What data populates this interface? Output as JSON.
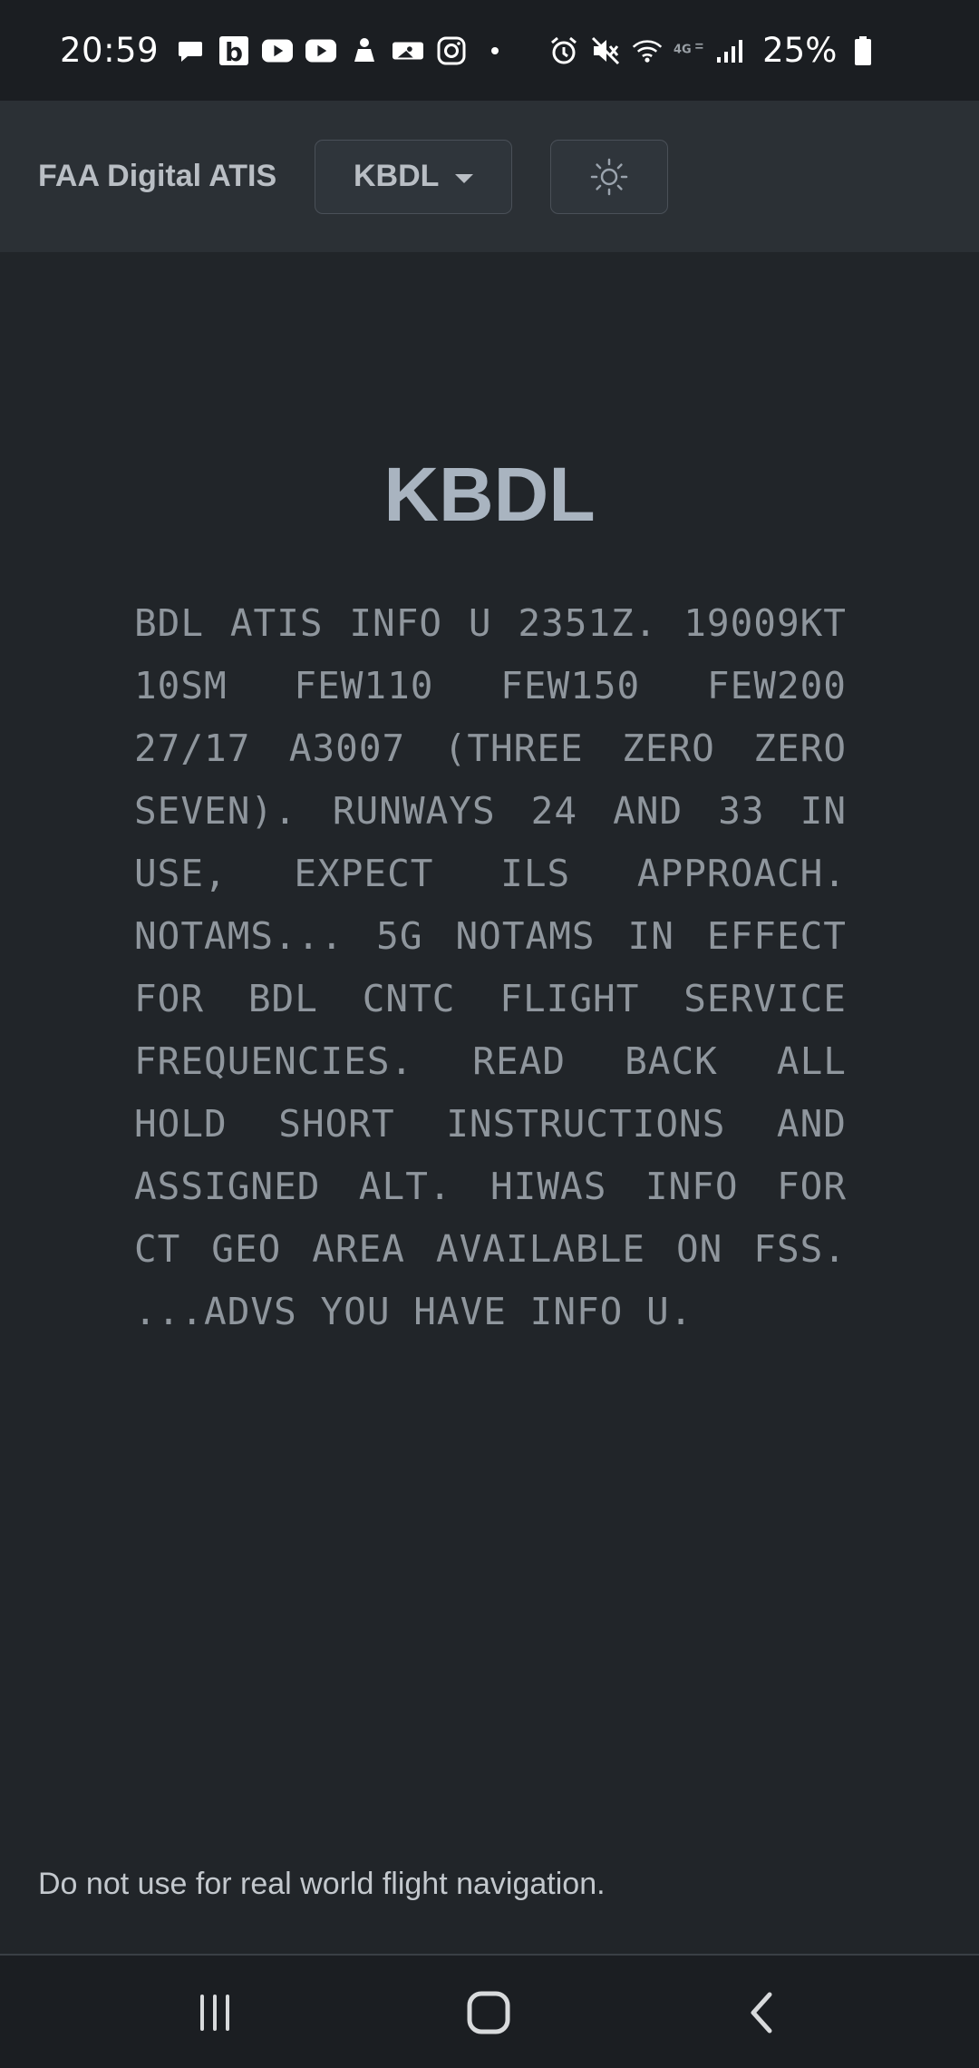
{
  "status_bar": {
    "time": "20:59",
    "battery_percent": "25%",
    "left_icons": [
      "chat-icon",
      "b-app-icon",
      "youtube-icon",
      "youtube-icon",
      "app-icon",
      "mlb-icon",
      "instagram-icon",
      "dot-icon"
    ],
    "right_icons": [
      "alarm-icon",
      "mute-icon",
      "wifi-icon",
      "4g-icon",
      "signal-icon",
      "battery-icon"
    ]
  },
  "navbar": {
    "brand": "FAA Digital ATIS",
    "airport_select": {
      "value": "KBDL"
    },
    "theme_toggle_icon": "sun-icon"
  },
  "main": {
    "airport_heading": "KBDL",
    "atis_text": "BDL ATIS INFO U 2351Z. 19009KT 10SM FEW110 FEW150 FEW200 27/17 A3007 (THREE ZERO ZERO SEVEN). RUNWAYS 24 AND 33 IN USE, EXPECT ILS APPROACH. NOTAMS... 5G NOTAMS IN EFFECT FOR BDL CNTC FLIGHT SERVICE FREQUENCIES. READ BACK ALL HOLD SHORT INSTRUCTIONS AND ASSIGNED ALT. HIWAS INFO FOR CT GEO AREA AVAILABLE ON FSS. ...ADVS YOU HAVE INFO U."
  },
  "footer": {
    "disclaimer": "Do not use for real world flight navigation."
  },
  "colors": {
    "background": "#212529",
    "navbar": "#2b3035",
    "heading": "#a9b4c0",
    "atis_text": "#8f969d"
  }
}
